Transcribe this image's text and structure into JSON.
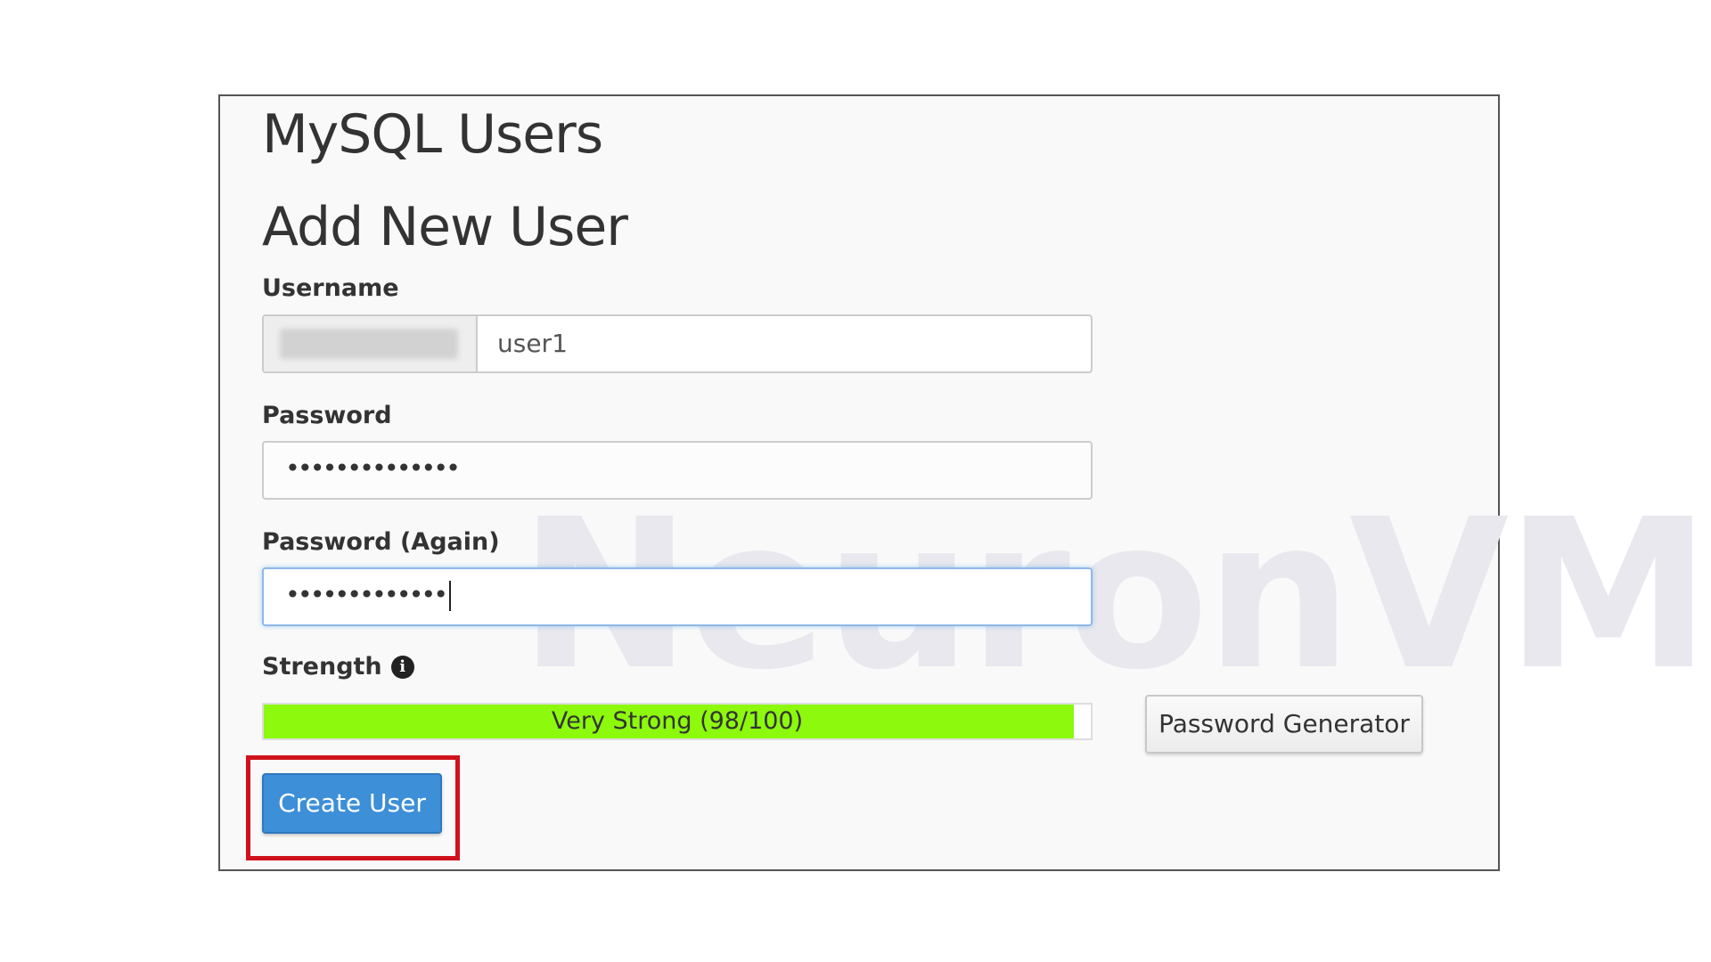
{
  "page": {
    "title": "MySQL Users",
    "section_title": "Add New User"
  },
  "watermark": "NeuronVM",
  "form": {
    "username_label": "Username",
    "username_value": "user1",
    "password_label": "Password",
    "password_value": "••••••••••••••",
    "password_again_label": "Password (Again)",
    "password_again_value": "•••••••••••••",
    "strength_label": "Strength",
    "strength_info_icon": "info-icon",
    "strength_text": "Very Strong (98/100)",
    "strength_value": 98,
    "strength_max": 100,
    "strength_color": "#8cf90d",
    "password_generator_label": "Password Generator",
    "create_user_label": "Create User"
  },
  "colors": {
    "primary_button": "#3d8fd8",
    "highlight": "#d0121c",
    "focus_border": "#8fb8e6"
  }
}
